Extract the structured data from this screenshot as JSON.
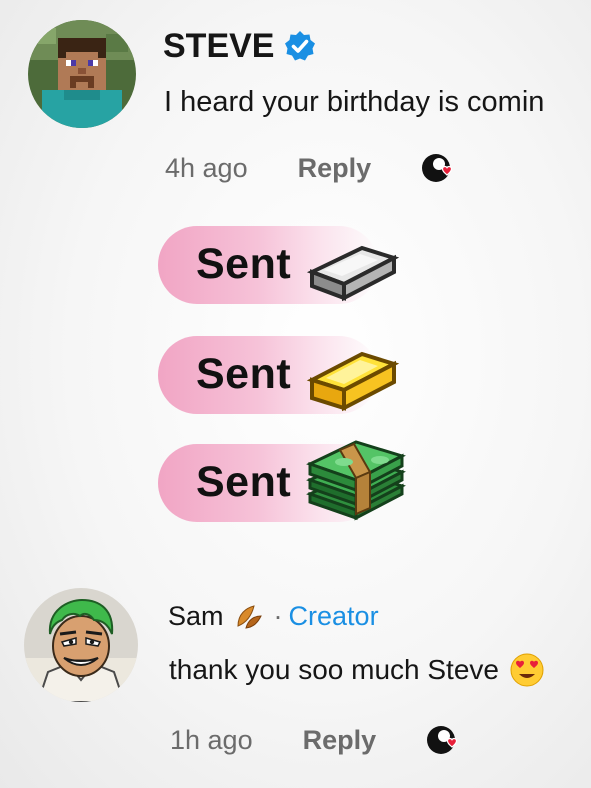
{
  "comments": [
    {
      "username": "STEVE",
      "verified": true,
      "text": "I heard your birthday is comin",
      "time": "4h ago",
      "reply_label": "Reply",
      "avatar": "minecraft-steve-avatar"
    },
    {
      "username": "Sam",
      "creator_separator": "·",
      "creator_label": "Creator",
      "text": "thank you soo much Steve",
      "time": "1h ago",
      "reply_label": "Reply",
      "avatar": "green-haired-anime-avatar"
    }
  ],
  "gifts": [
    {
      "label": "Sent",
      "icon": "iron-ingot-icon"
    },
    {
      "label": "Sent",
      "icon": "gold-ingot-icon"
    },
    {
      "label": "Sent",
      "icon": "money-stack-icon"
    }
  ],
  "colors": {
    "verified": "#1a8fe3",
    "creator": "#1a8fe3",
    "pill_pink": "#f1a5c4",
    "like_heart": "#e8203a"
  }
}
